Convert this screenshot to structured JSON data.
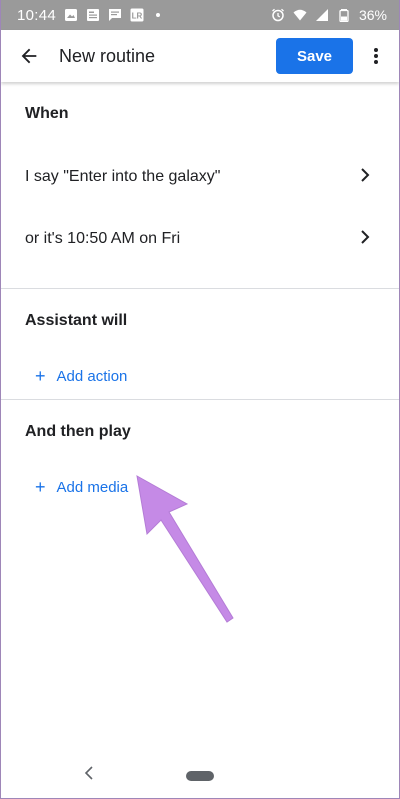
{
  "status_bar": {
    "time": "10:44",
    "notification_icons": [
      "image-icon",
      "news-icon",
      "message-icon",
      "lightroom-icon"
    ],
    "system_icons": [
      "alarm-icon",
      "wifi-icon",
      "signal-icon",
      "battery-icon"
    ],
    "lightroom_label": "LR",
    "battery_percent": "36%"
  },
  "app_bar": {
    "title": "New routine",
    "save_label": "Save"
  },
  "sections": {
    "when": {
      "header": "When",
      "items": [
        {
          "label": "I say \"Enter into the galaxy\""
        },
        {
          "label": "or it's 10:50 AM on Fri"
        }
      ]
    },
    "assistant": {
      "header": "Assistant will",
      "add_label": "Add action"
    },
    "then_play": {
      "header": "And then play",
      "add_label": "Add media"
    }
  },
  "colors": {
    "accent": "#1a73e8",
    "status_bar": "#9a9a9a",
    "annotation_arrow": "#c58ae6"
  }
}
